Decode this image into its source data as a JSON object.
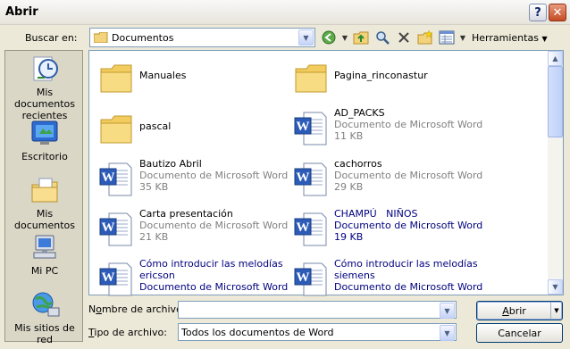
{
  "window": {
    "title": "Abrir",
    "help_glyph": "?",
    "close_glyph": "✕"
  },
  "lookin": {
    "label": "Buscar en:",
    "value": "Documentos"
  },
  "toolbar": {
    "tools_label": "Herramientas"
  },
  "places": [
    {
      "id": "recent",
      "label_line1": "Mis documentos",
      "label_line2": "recientes",
      "icon": "recent-documents-icon"
    },
    {
      "id": "desktop",
      "label_line1": "Escritorio",
      "label_line2": "",
      "icon": "desktop-icon"
    },
    {
      "id": "mydocs",
      "label_line1": "Mis documentos",
      "label_line2": "",
      "icon": "my-documents-icon"
    },
    {
      "id": "mypc",
      "label_line1": "Mi PC",
      "label_line2": "",
      "icon": "my-computer-icon"
    },
    {
      "id": "network",
      "label_line1": "Mis sitios de red",
      "label_line2": "",
      "icon": "network-places-icon"
    }
  ],
  "files": [
    {
      "name": "Manuales",
      "type": "",
      "size": "",
      "kind": "folder",
      "highlight": false
    },
    {
      "name": "Pagina_rinconastur",
      "type": "",
      "size": "",
      "kind": "folder",
      "highlight": false
    },
    {
      "name": "pascal",
      "type": "",
      "size": "",
      "kind": "folder",
      "highlight": false
    },
    {
      "name": "AD_PACKS",
      "type": "Documento de Microsoft Word",
      "size": "11 KB",
      "kind": "word",
      "highlight": false
    },
    {
      "name": "Bautizo Abril",
      "type": "Documento de Microsoft Word",
      "size": "35 KB",
      "kind": "word",
      "highlight": false
    },
    {
      "name": "cachorros",
      "type": "Documento de Microsoft Word",
      "size": "29 KB",
      "kind": "word",
      "highlight": false
    },
    {
      "name": "Carta presentación",
      "type": "Documento de Microsoft Word",
      "size": "21 KB",
      "kind": "word",
      "highlight": false
    },
    {
      "name": "CHAMPÚ   NIÑOS",
      "type": "Documento de Microsoft Word",
      "size": "19 KB",
      "kind": "word",
      "highlight": true
    },
    {
      "name": "Cómo introducir las melodías",
      "name2": "ericson",
      "type": "Documento de Microsoft Word",
      "size": "",
      "kind": "word",
      "highlight": true
    },
    {
      "name": "Cómo introducir las melodías",
      "name2": "siemens",
      "type": "Documento de Microsoft Word",
      "size": "",
      "kind": "word",
      "highlight": true
    }
  ],
  "filename": {
    "label_pre": "N",
    "label_u": "o",
    "label_rest": "mbre de archivo:",
    "value": ""
  },
  "filetype": {
    "label_u": "T",
    "label_rest": "ipo de archivo:",
    "value": "Todos los documentos de Word"
  },
  "buttons": {
    "open_u": "A",
    "open_rest": "brir",
    "cancel": "Cancelar"
  },
  "colors": {
    "highlight_text": "#00007F",
    "secondary_text": "#808080",
    "accent": "#003C74"
  }
}
